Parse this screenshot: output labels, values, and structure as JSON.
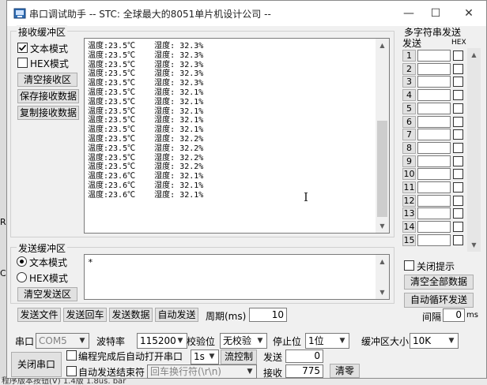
{
  "window": {
    "title": "串口调试助手 -- STC: 全球最大的8051单片机设计公司 --"
  },
  "background": {
    "left_letters": [
      "R",
      "C"
    ],
    "bottom_text": "程序版本按钮(V) 1.4版      1.8us. bar"
  },
  "receive": {
    "group_label": "接收缓冲区",
    "text_mode_label": "文本模式",
    "hex_mode_label": "HEX模式",
    "clear_label": "清空接收区",
    "save_label": "保存接收数据",
    "copy_label": "复制接收数据",
    "lines": [
      "温度:23.5℃    湿度: 32.3%",
      "温度:23.5℃    湿度: 32.3%",
      "温度:23.5℃    湿度: 32.3%",
      "温度:23.5℃    湿度: 32.3%",
      "温度:23.5℃    湿度: 32.3%",
      "温度:23.5℃    湿度: 32.1%",
      "温度:23.5℃    湿度: 32.1%",
      "温度:23.5℃    湿度: 32.1%",
      "温度:23.5℃    湿度: 32.1%",
      "温度:23.5℃    湿度: 32.1%",
      "温度:23.5℃    湿度: 32.2%",
      "温度:23.5℃    湿度: 32.2%",
      "温度:23.5℃    湿度: 32.2%",
      "温度:23.5℃    湿度: 32.2%",
      "温度:23.6℃    湿度: 32.1%",
      "温度:23.6℃    湿度: 32.1%",
      "温度:23.6℃    湿度: 32.1%"
    ]
  },
  "send": {
    "group_label": "发送缓冲区",
    "text_mode_label": "文本模式",
    "hex_mode_label": "HEX模式",
    "clear_label": "清空发送区",
    "content": "*",
    "send_file_label": "发送文件",
    "send_enter_label": "发送回车",
    "send_data_label": "发送数据",
    "auto_send_label": "自动发送",
    "period_label": "周期(ms)",
    "period_value": "10"
  },
  "multi": {
    "title": "多字符串发送",
    "send_header": "发送",
    "hex_header": "HEX",
    "rows": [
      "1",
      "2",
      "3",
      "4",
      "5",
      "6",
      "7",
      "8",
      "9",
      "10",
      "11",
      "12",
      "13",
      "14",
      "15"
    ],
    "close_hint_label": "关闭提示",
    "clear_all_label": "清空全部数据",
    "auto_loop_label": "自动循环发送",
    "interval_label": "间隔",
    "interval_value": "0",
    "interval_unit": "ms"
  },
  "serial": {
    "port_label": "串口",
    "port_value": "COM5",
    "baud_label": "波特率",
    "baud_value": "115200",
    "parity_label": "校验位",
    "parity_value": "无校验",
    "stop_label": "停止位",
    "stop_value": "1位",
    "buffer_label": "缓冲区大小",
    "buffer_value": "10K",
    "close_port_label": "关闭串口",
    "auto_open_label": "编程完成后自动打开串口",
    "auto_open_combo": "1s",
    "flow_label": "流控制",
    "auto_end_label": "自动发送结束符",
    "end_char_value": "回车换行符(\\r\\n)",
    "sent_label": "发送",
    "sent_value": "0",
    "recv_label": "接收",
    "recv_value": "775",
    "reset_label": "清零"
  }
}
